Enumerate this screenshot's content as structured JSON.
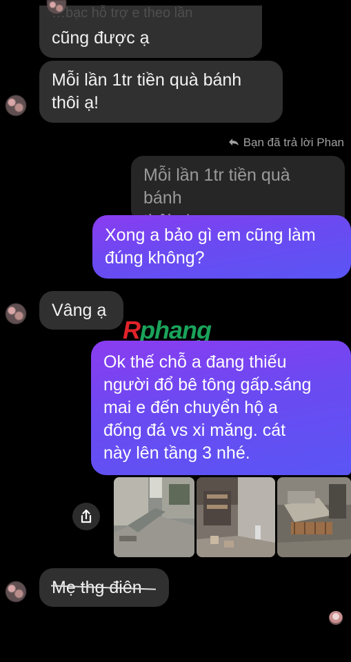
{
  "messages": {
    "m1": "cũng được ạ",
    "m1_partial_top": "…bạc hỗ trợ e theo lần",
    "m2_line1": "Mỗi lần 1tr tiền quà bánh",
    "m2_line2": "thôi ạ!",
    "reply_label": "Bạn đã trả lời Phan",
    "quoted_line1": "Mỗi lần 1tr tiền quà bánh",
    "quoted_line2": "thôi ạ!",
    "m3_line1": "Xong a bảo gì em cũng làm",
    "m3_line2": "đúng không?",
    "m4": "Vâng ạ",
    "m5_line1": "Ok thế chỗ a đang thiếu",
    "m5_line2": "người đổ bê tông gấp.sáng",
    "m5_line3": "mai e đến chuyển hộ a",
    "m5_line4": "đống đá vs xi măng. cát",
    "m5_line5": "này lên tầng 3 nhé.",
    "m6": "Mẹ thg điên"
  },
  "watermark": {
    "a": "R",
    "rest": "phang"
  },
  "icons": {
    "share": "share-icon",
    "reply": "reply-arrow-icon"
  },
  "colors": {
    "incoming_bubble": "#303030",
    "outgoing_bubble_start": "#8a3cf0",
    "outgoing_bubble_end": "#5a55f4",
    "background": "#000000"
  }
}
